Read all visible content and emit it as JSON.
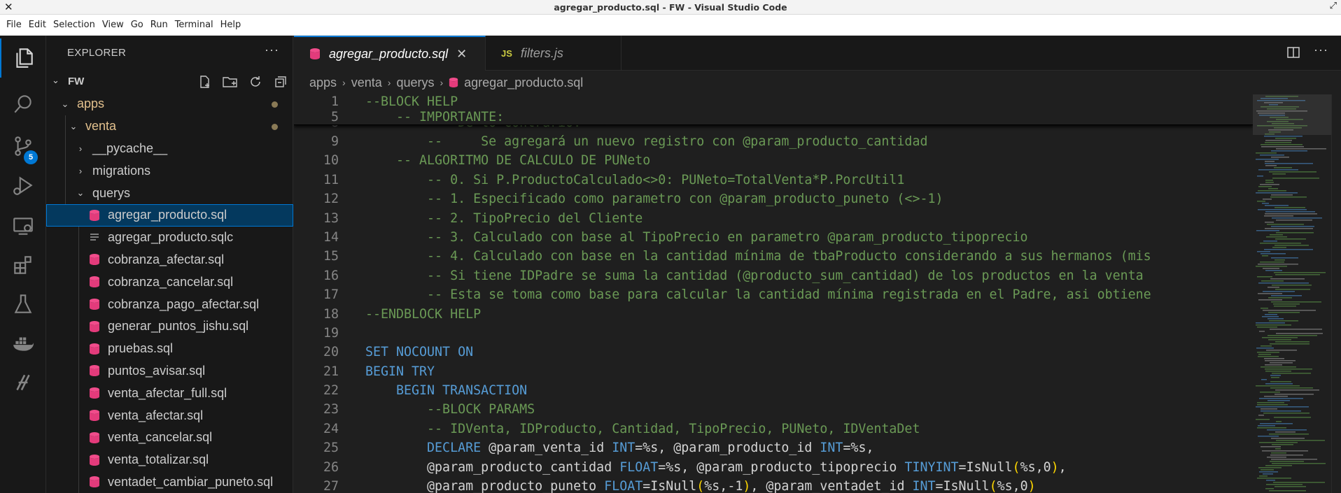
{
  "window": {
    "title": "agregar_producto.sql - FW - Visual Studio Code",
    "close_glyph": "✕",
    "restore_glyph": "⤢"
  },
  "menu": [
    "File",
    "Edit",
    "Selection",
    "View",
    "Go",
    "Run",
    "Terminal",
    "Help"
  ],
  "activity_bar": {
    "items": [
      "explorer-icon",
      "search-icon",
      "source-control-icon",
      "run-debug-icon",
      "remote-explorer-icon",
      "extensions-icon",
      "testing-icon",
      "docker-icon",
      "kubernetes-icon"
    ],
    "source_control_badge": "5",
    "accent": "#0078d4"
  },
  "sidebar": {
    "title": "EXPLORER",
    "more": "···",
    "workspace": "FW",
    "tree": [
      {
        "label": "apps",
        "kind": "folder-open",
        "modified": true
      },
      {
        "label": "venta",
        "kind": "folder-open",
        "modified": true
      },
      {
        "label": "__pycache__",
        "kind": "folder-closed"
      },
      {
        "label": "migrations",
        "kind": "folder-closed"
      },
      {
        "label": "querys",
        "kind": "folder-open"
      },
      {
        "label": "agregar_producto.sql",
        "kind": "sql",
        "selected": true
      },
      {
        "label": "agregar_producto.sqlc",
        "kind": "text"
      },
      {
        "label": "cobranza_afectar.sql",
        "kind": "sql"
      },
      {
        "label": "cobranza_cancelar.sql",
        "kind": "sql"
      },
      {
        "label": "cobranza_pago_afectar.sql",
        "kind": "sql"
      },
      {
        "label": "generar_puntos_jishu.sql",
        "kind": "sql"
      },
      {
        "label": "pruebas.sql",
        "kind": "sql"
      },
      {
        "label": "puntos_avisar.sql",
        "kind": "sql"
      },
      {
        "label": "venta_afectar_full.sql",
        "kind": "sql"
      },
      {
        "label": "venta_afectar.sql",
        "kind": "sql"
      },
      {
        "label": "venta_cancelar.sql",
        "kind": "sql"
      },
      {
        "label": "venta_totalizar.sql",
        "kind": "sql"
      },
      {
        "label": "ventadet_cambiar_puneto.sql",
        "kind": "sql"
      }
    ]
  },
  "tabs": [
    {
      "label": "agregar_producto.sql",
      "active": true,
      "icon": "database-icon",
      "close": "✕"
    },
    {
      "label": "filters.js",
      "active": false,
      "icon": "js-icon",
      "icon_text": "JS"
    }
  ],
  "tabs_more": "···",
  "breadcrumb": [
    "apps",
    "venta",
    "querys",
    "agregar_producto.sql"
  ],
  "breadcrumb_sep": "›",
  "code": {
    "sticky": [
      {
        "n": "1",
        "t": [
          [
            "cm",
            "--BLOCK HELP"
          ]
        ]
      },
      {
        "n": "5",
        "t": [
          [
            "cm",
            "    -- IMPORTANTE:"
          ]
        ]
      }
    ],
    "partial": {
      "n": "8",
      "t": [
        [
          "cm",
          "        --  De lo contrario:"
        ]
      ]
    },
    "lines": [
      {
        "n": "9",
        "t": [
          [
            "cm",
            "        --     Se agregará un nuevo registro con @param_producto_cantidad"
          ]
        ]
      },
      {
        "n": "10",
        "t": [
          [
            "cm",
            "    -- ALGORITMO DE CALCULO DE PUNeto"
          ]
        ]
      },
      {
        "n": "11",
        "t": [
          [
            "cm",
            "        -- 0. Si P.ProductoCalculado<>0: PUNeto=TotalVenta*P.PorcUtil1"
          ]
        ]
      },
      {
        "n": "12",
        "t": [
          [
            "cm",
            "        -- 1. Especificado como parametro con @param_producto_puneto (<>-1)"
          ]
        ]
      },
      {
        "n": "13",
        "t": [
          [
            "cm",
            "        -- 2. TipoPrecio del Cliente"
          ]
        ]
      },
      {
        "n": "14",
        "t": [
          [
            "cm",
            "        -- 3. Calculado con base al TipoPrecio en parametro @param_producto_tipoprecio"
          ]
        ]
      },
      {
        "n": "15",
        "t": [
          [
            "cm",
            "        -- 4. Calculado con base en la cantidad mínima de tbaProducto considerando a sus hermanos (mis"
          ]
        ]
      },
      {
        "n": "16",
        "t": [
          [
            "cm",
            "        -- Si tiene IDPadre se suma la cantidad (@producto_sum_cantidad) de los productos en la venta"
          ]
        ]
      },
      {
        "n": "17",
        "t": [
          [
            "cm",
            "        -- Esta se toma como base para calcular la cantidad mínima registrada en el Padre, asi obtiene"
          ]
        ]
      },
      {
        "n": "18",
        "t": [
          [
            "cm",
            "--ENDBLOCK HELP"
          ]
        ]
      },
      {
        "n": "19",
        "t": [
          [
            "pl",
            ""
          ]
        ]
      },
      {
        "n": "20",
        "t": [
          [
            "kw",
            "SET NOCOUNT ON"
          ]
        ]
      },
      {
        "n": "21",
        "t": [
          [
            "kw",
            "BEGIN TRY"
          ]
        ]
      },
      {
        "n": "22",
        "t": [
          [
            "kw",
            "    BEGIN TRANSACTION"
          ]
        ]
      },
      {
        "n": "23",
        "t": [
          [
            "cm",
            "        --BLOCK PARAMS"
          ]
        ]
      },
      {
        "n": "24",
        "t": [
          [
            "cm",
            "        -- IDVenta, IDProducto, Cantidad, TipoPrecio, PUNeto, IDVentaDet"
          ]
        ]
      },
      {
        "n": "25",
        "t": [
          [
            "kw",
            "        DECLARE "
          ],
          [
            "pl",
            "@param_venta_id "
          ],
          [
            "kw",
            "INT"
          ],
          [
            "pl",
            "=%s, @param_producto_id "
          ],
          [
            "kw",
            "INT"
          ],
          [
            "pl",
            "=%s,"
          ]
        ]
      },
      {
        "n": "26",
        "t": [
          [
            "pl",
            "        @param_producto_cantidad "
          ],
          [
            "kw",
            "FLOAT"
          ],
          [
            "pl",
            "=%s, @param_producto_tipoprecio "
          ],
          [
            "kw",
            "TINYINT"
          ],
          [
            "pl",
            "=IsNull"
          ],
          [
            "pn",
            "("
          ],
          [
            "pl",
            "%s,0"
          ],
          [
            "pn",
            ")"
          ],
          [
            "pl",
            ","
          ]
        ]
      },
      {
        "n": "27",
        "t": [
          [
            "pl",
            "        @param_producto_puneto "
          ],
          [
            "kw",
            "FLOAT"
          ],
          [
            "pl",
            "=IsNull"
          ],
          [
            "pn",
            "("
          ],
          [
            "pl",
            "%s,-1"
          ],
          [
            "pn",
            ")"
          ],
          [
            "pl",
            ", @param_ventadet_id "
          ],
          [
            "kw",
            "INT"
          ],
          [
            "pl",
            "=IsNull"
          ],
          [
            "pn",
            "("
          ],
          [
            "pl",
            "%s,0"
          ],
          [
            "pn",
            ")"
          ]
        ]
      }
    ]
  }
}
